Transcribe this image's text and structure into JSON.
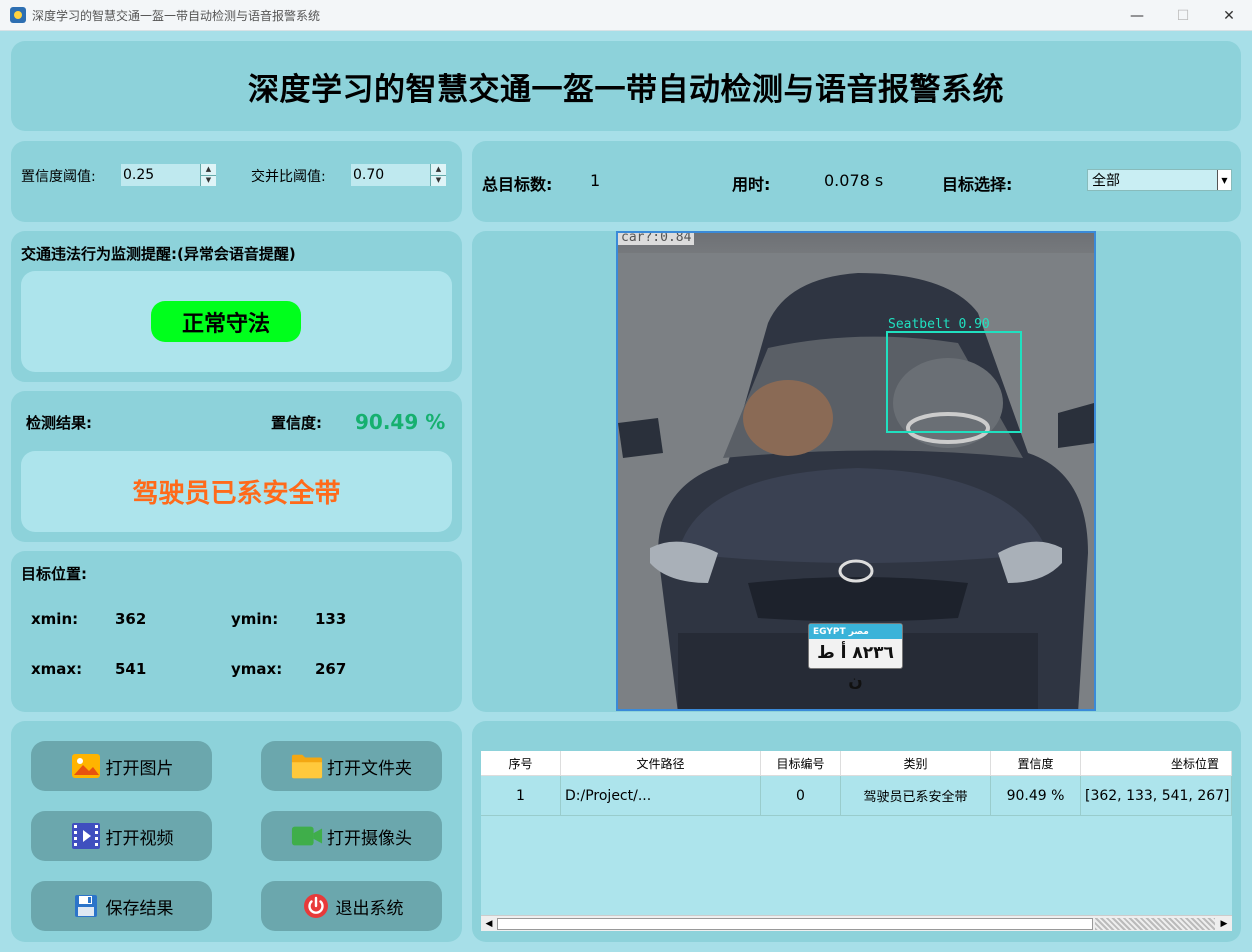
{
  "window": {
    "title": "深度学习的智慧交通一盔一带自动检测与语音报警系统",
    "minimize": "—",
    "maximize": "☐",
    "close": "✕"
  },
  "header": {
    "title": "深度学习的智慧交通一盔一带自动检测与语音报警系统"
  },
  "thresholds": {
    "conf_label": "置信度阈值:",
    "conf_value": "0.25",
    "iou_label": "交并比阈值:",
    "iou_value": "0.70",
    "up": "▲",
    "down": "▼"
  },
  "stats": {
    "total_label": "总目标数:",
    "total_value": "1",
    "time_label": "用时:",
    "time_value": "0.078 s",
    "select_label": "目标选择:",
    "select_value": "全部",
    "select_arrow": "▼"
  },
  "violation": {
    "title": "交通违法行为监测提醒:(异常会语音提醒)",
    "status": "正常守法"
  },
  "result": {
    "label": "检测结果:",
    "conf_label": "置信度:",
    "conf_value": "90.49 %",
    "text": "驾驶员已系安全带"
  },
  "position": {
    "title": "目标位置:",
    "xmin_label": "xmin:",
    "xmin": "362",
    "ymin_label": "ymin:",
    "ymin": "133",
    "xmax_label": "xmax:",
    "xmax": "541",
    "ymax_label": "ymax:",
    "ymax": "267"
  },
  "image": {
    "car_label": "car?:0.84",
    "seatbelt_label": "Seatbelt  0.90",
    "plate_top": "EGYPT   مصر",
    "plate_bottom": "٨٢٣٦  أ ط ن"
  },
  "buttons": {
    "open_image": "打开图片",
    "open_folder": "打开文件夹",
    "open_video": "打开视频",
    "open_camera": "打开摄像头",
    "save": "保存结果",
    "exit": "退出系统"
  },
  "table": {
    "headers": [
      "序号",
      "文件路径",
      "目标编号",
      "类别",
      "置信度",
      "坐标位置"
    ],
    "rows": [
      [
        "1",
        "D:/Project/...",
        "0",
        "驾驶员已系安全带",
        "90.49 %",
        "[362, 133, 541, 267]"
      ]
    ],
    "scroll_left": "◀",
    "scroll_right": "▶"
  },
  "colors": {
    "background": "#a7dfe8",
    "panel": "#8dd2da",
    "status_green": "#00ff1c",
    "result_orange": "#ff6a1a",
    "confidence_green": "#16b06f",
    "button": "#6ba7ad"
  }
}
